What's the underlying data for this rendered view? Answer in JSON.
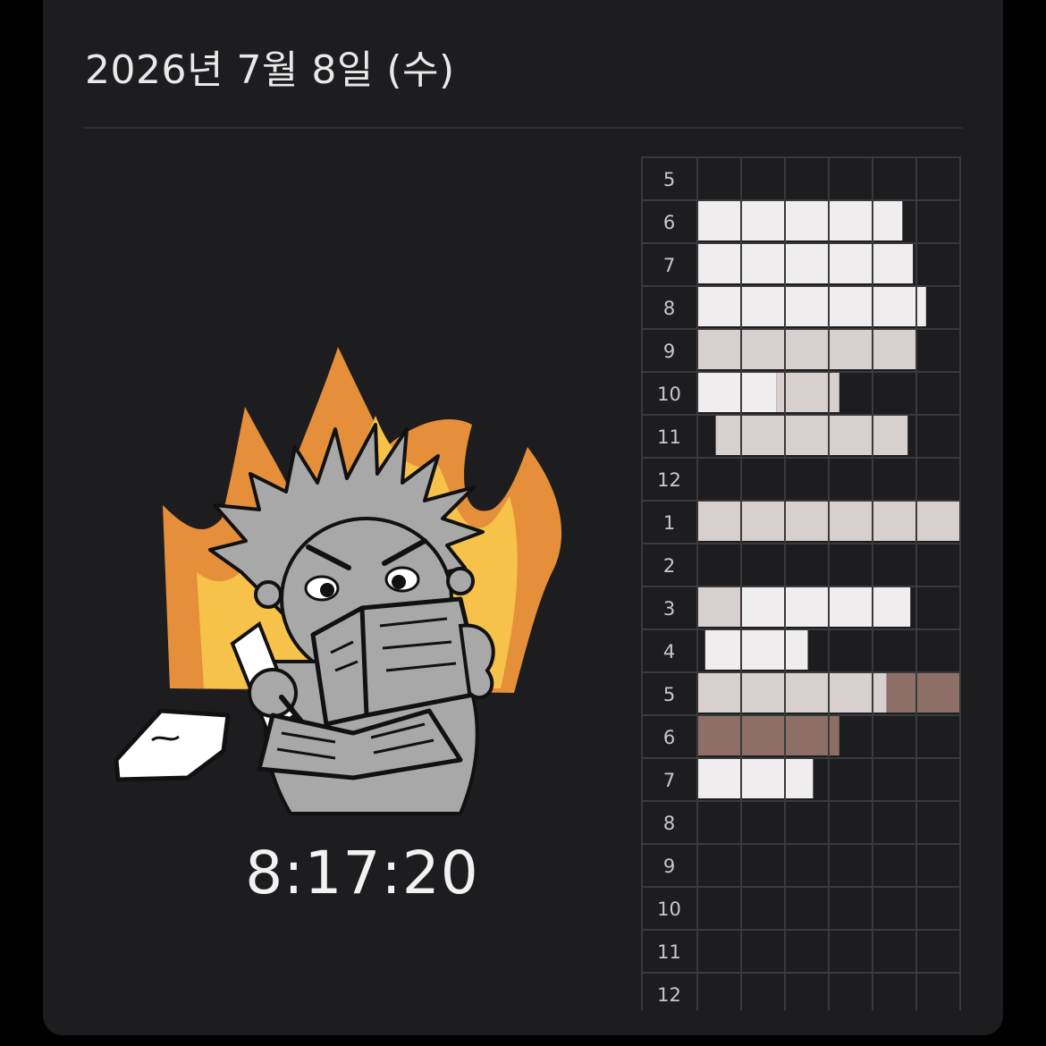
{
  "header": {
    "date": "2026년 7월 8일 (수)"
  },
  "timer": {
    "elapsed": "8:17:20"
  },
  "illustration": {
    "icon": "studying-on-fire-character-icon",
    "colors": {
      "flame_outer": "#e58f3a",
      "flame_inner": "#f6c24a",
      "character": "#a8a8a8",
      "outline": "#111111",
      "paper": "#ffffff"
    }
  },
  "timetable": {
    "hours": [
      "5",
      "6",
      "7",
      "8",
      "9",
      "10",
      "11",
      "12",
      "1",
      "2",
      "3",
      "4",
      "5",
      "6",
      "7",
      "8",
      "9",
      "10",
      "11",
      "12"
    ],
    "slots_per_hour": 6,
    "colors": {
      "grid_line": "#3a3a3d",
      "label": "#c9c9cc",
      "light": "#efedee",
      "mid": "#d8cfcf",
      "dark": "#8d6f67"
    },
    "segments": [
      {
        "hour": 1,
        "start": 0.0,
        "end": 0.78,
        "tone": "light"
      },
      {
        "hour": 2,
        "start": 0.0,
        "end": 0.82,
        "tone": "light"
      },
      {
        "hour": 3,
        "start": 0.0,
        "end": 0.87,
        "tone": "light"
      },
      {
        "hour": 4,
        "start": 0.0,
        "end": 0.83,
        "tone": "mid"
      },
      {
        "hour": 5,
        "start": 0.0,
        "end": 0.3,
        "tone": "light"
      },
      {
        "hour": 5,
        "start": 0.3,
        "end": 0.54,
        "tone": "mid"
      },
      {
        "hour": 6,
        "start": 0.07,
        "end": 0.8,
        "tone": "mid"
      },
      {
        "hour": 8,
        "start": 0.0,
        "end": 1.0,
        "tone": "mid"
      },
      {
        "hour": 10,
        "start": 0.0,
        "end": 0.17,
        "tone": "mid"
      },
      {
        "hour": 10,
        "start": 0.17,
        "end": 0.81,
        "tone": "light"
      },
      {
        "hour": 11,
        "start": 0.03,
        "end": 0.42,
        "tone": "light"
      },
      {
        "hour": 12,
        "start": 0.0,
        "end": 0.72,
        "tone": "mid"
      },
      {
        "hour": 12,
        "start": 0.72,
        "end": 1.0,
        "tone": "dark"
      },
      {
        "hour": 13,
        "start": 0.0,
        "end": 0.54,
        "tone": "dark"
      },
      {
        "hour": 14,
        "start": 0.0,
        "end": 0.44,
        "tone": "light"
      }
    ]
  }
}
